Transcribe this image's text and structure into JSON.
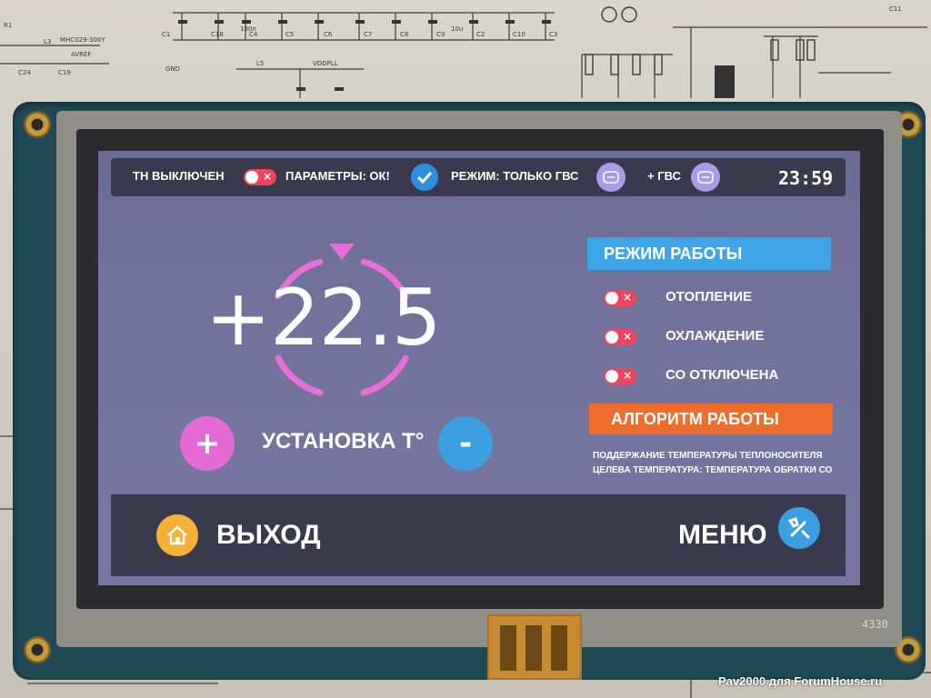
{
  "photo": {
    "watermark": "Pav2000 для ForumHouse.ru",
    "board_marking": "4330",
    "schematic_labels": [
      "C1",
      "C18",
      "C4",
      "C5",
      "C6",
      "C7",
      "C8",
      "C9",
      "C2",
      "C10",
      "C3",
      "L3",
      "L5",
      "C24",
      "C19",
      "GND",
      "C11",
      "R1",
      "100n",
      "10u",
      "MHC029-300Y",
      "AVREF",
      "VDDPLL"
    ]
  },
  "status_bar": {
    "heat_pump_label": "ТН ВЫКЛЮЧЕН",
    "params_label": "ПАРАМЕТРЫ: ОК!",
    "mode_label": "РЕЖИМ: ТОЛЬКО ГВС",
    "dhw_label": "+ ГВС",
    "clock": "23:59",
    "icons": {
      "heat_pump_toggle": "toggle-off-icon",
      "params_status": "check-circle-icon",
      "mode": "boiler-icon",
      "dhw": "boiler-icon"
    }
  },
  "setpoint": {
    "value": "+22.5",
    "label": "УСТАНОВКА Т°",
    "plus": "+",
    "minus": "-"
  },
  "operating_mode": {
    "title": "РЕЖИМ РАБОТЫ",
    "items": [
      {
        "label": "ОТОПЛЕНИЕ",
        "enabled": false
      },
      {
        "label": "ОХЛАЖДЕНИЕ",
        "enabled": false
      },
      {
        "label": "СО ОТКЛЮЧЕНА",
        "enabled": false
      }
    ]
  },
  "algorithm": {
    "title": "АЛГОРИТМ РАБОТЫ",
    "line1": "ПОДДЕРЖАНИЕ ТЕМПЕРАТУРЫ ТЕПЛОНОСИТЕЛЯ",
    "line2": "ЦЕЛЕВА ТЕМПЕРАТУРА: ТЕМПЕРАТУРА ОБРАТКИ СО"
  },
  "footer": {
    "exit_label": "ВЫХОД",
    "menu_label": "МЕНЮ",
    "exit_icon": "home-icon",
    "menu_icon": "tools-icon"
  },
  "colors": {
    "screen_bg": "#7070a0",
    "bar_bg": "#3a3a4f",
    "toggle_off": "#f0445c",
    "accent_blue": "#3ea6e8",
    "accent_orange": "#ee6d2c",
    "dial_pink": "#e66fd8",
    "plus_pink": "#e46ad6",
    "minus_blue": "#3b9fe0",
    "check_blue": "#2f8ee0",
    "boiler_violet": "#a89be8",
    "home_yellow": "#f4b13a"
  }
}
